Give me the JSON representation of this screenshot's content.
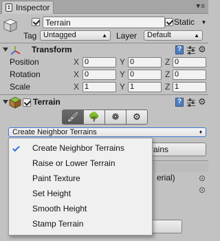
{
  "window": {
    "tab_title": "Inspector"
  },
  "object": {
    "name": "Terrain",
    "active": true,
    "static_label": "Static",
    "static_checked": true,
    "tag_label": "Tag",
    "tag_value": "Untagged",
    "layer_label": "Layer",
    "layer_value": "Default"
  },
  "transform": {
    "title": "Transform",
    "rows": [
      {
        "label": "Position",
        "x": "0",
        "y": "0",
        "z": "0"
      },
      {
        "label": "Rotation",
        "x": "0",
        "y": "0",
        "z": "0"
      },
      {
        "label": "Scale",
        "x": "1",
        "y": "1",
        "z": "1"
      }
    ],
    "axis_labels": [
      "X",
      "Y",
      "Z"
    ]
  },
  "terrain": {
    "title": "Terrain",
    "enabled": true,
    "tools": [
      "paint-brush-icon",
      "tree-icon",
      "details-icon",
      "settings-gear-icon"
    ],
    "selected_tool": 0,
    "mode_dropdown": "Create Neighbor Terrains",
    "background_button_fragment": "rains",
    "background_material_fragment": "erial)"
  },
  "menu": {
    "items": [
      {
        "label": "Create Neighbor Terrains",
        "checked": true
      },
      {
        "label": "Raise or Lower Terrain",
        "checked": false
      },
      {
        "label": "Paint Texture",
        "checked": false
      },
      {
        "label": "Set Height",
        "checked": false
      },
      {
        "label": "Smooth Height",
        "checked": false
      },
      {
        "label": "Stamp Terrain",
        "checked": false
      }
    ]
  },
  "colors": {
    "accent": "#3b78d8",
    "panel": "#c2c2c2",
    "menu_bg": "#f0f0f0"
  }
}
